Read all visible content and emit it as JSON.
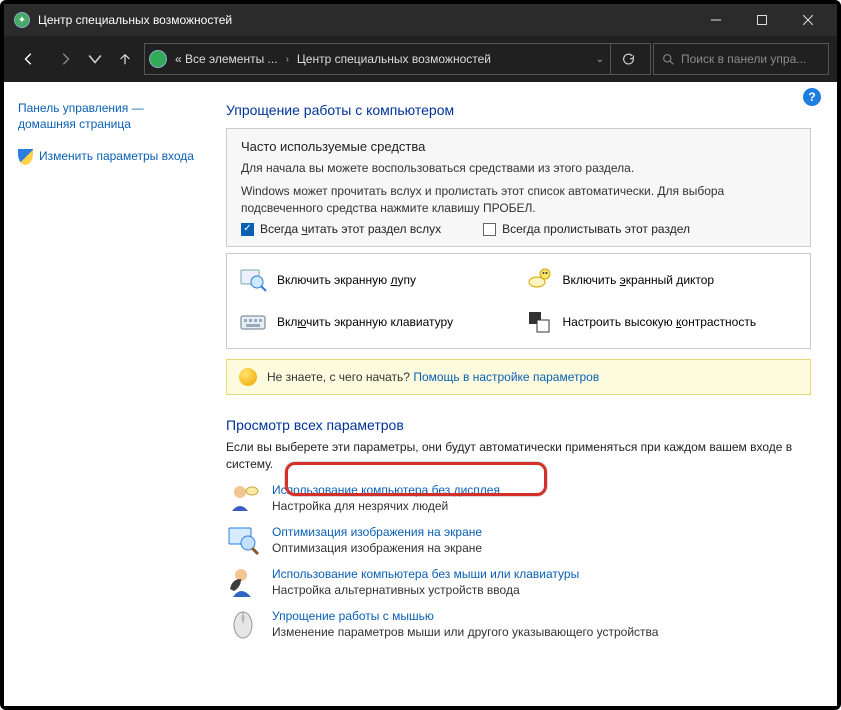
{
  "window": {
    "title": "Центр специальных возможностей"
  },
  "breadcrumb": {
    "root": "« Все элементы ...",
    "current": "Центр специальных возможностей"
  },
  "search": {
    "placeholder": "Поиск в панели упра..."
  },
  "sidebar": {
    "home1": "Панель управления —",
    "home2": "домашняя страница",
    "signin": "Изменить параметры входа"
  },
  "main": {
    "h1": "Упрощение работы с компьютером",
    "box_h": "Часто используемые средства",
    "box_p1": "Для начала вы можете воспользоваться средствами из этого раздела.",
    "box_p2": "Windows может прочитать вслух и пролистать этот список автоматически. Для выбора подсвеченного средства нажмите клавишу ПРОБЕЛ.",
    "cb1_pre": "Всегда ",
    "cb1_u": "ч",
    "cb1_post": "итать этот раздел вслух",
    "cb2": "Всегда пролистывать этот раздел",
    "tool1_pre": "Включить экранную ",
    "tool1_u": "л",
    "tool1_post": "упу",
    "tool2_pre": "Включить ",
    "tool2_u": "э",
    "tool2_post": "кранный диктор",
    "tool3_pre": "Вкл",
    "tool3_u": "ю",
    "tool3_post": "чить экранную клавиатуру",
    "tool4_pre": "Настроить высокую ",
    "tool4_u": "к",
    "tool4_post": "онтрастность",
    "hint_q": "Не знаете, с чего начать?",
    "hint_link": "Помощь в настройке параметров",
    "h2": "Просмотр всех параметров",
    "h2_sub": "Если вы выберете эти параметры, они будут автоматически применяться при каждом вашем входе в систему.",
    "p1_link": "Использование компьютера без дисплея",
    "p1_sub": "Настройка для незрячих людей",
    "p2_link": "Оптимизация изображения на экране",
    "p2_sub": "Оптимизация изображения на экране",
    "p3_link": "Использование компьютера без мыши или клавиатуры",
    "p3_sub": "Настройка альтернативных устройств ввода",
    "p4_link": "Упрощение работы с мышью",
    "p4_sub": "Изменение параметров мыши или другого указывающего устройства"
  }
}
